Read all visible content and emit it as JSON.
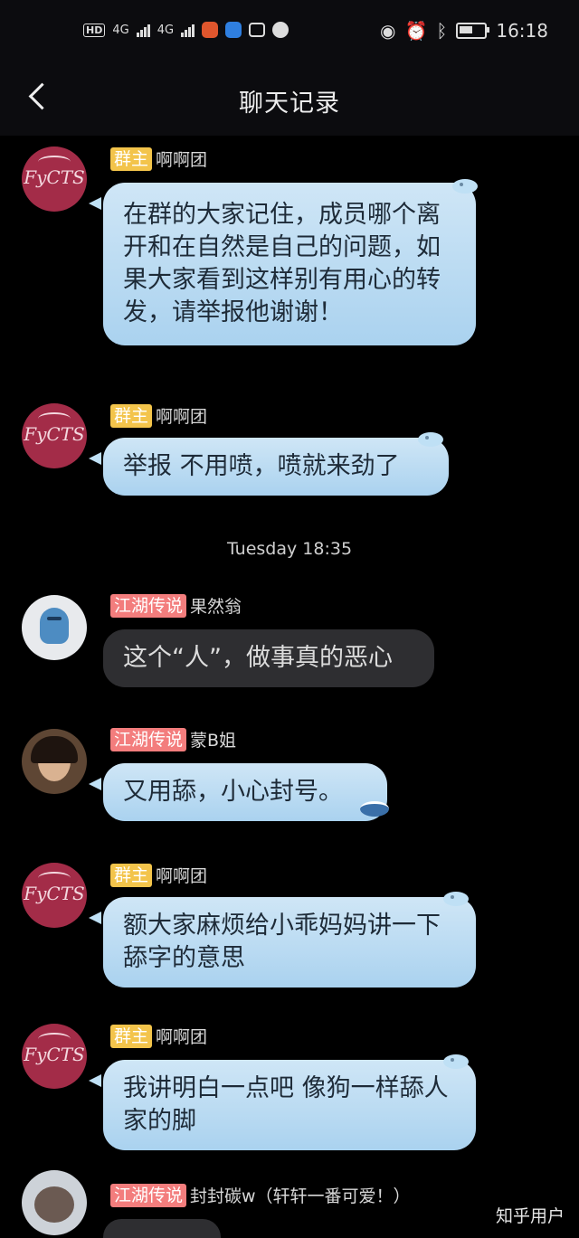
{
  "status_bar": {
    "hd_label": "HD",
    "signal1": "4G",
    "signal2": "4G",
    "time": "16:18",
    "icons": [
      "hd-icon",
      "signal-icon",
      "signal-icon",
      "app-icon",
      "shield-icon",
      "bilibili-icon",
      "wechat-icon",
      "eye-icon",
      "alarm-icon",
      "bluetooth-icon",
      "battery-icon"
    ]
  },
  "header": {
    "title": "聊天记录"
  },
  "messages": [
    {
      "badge": "群主",
      "sender": "啊啊团",
      "text": "在群的大家记住，成员哪个离开和在自然是自己的问题，如果大家看到这样别有用心的转发，请举报他谢谢！"
    },
    {
      "badge": "群主",
      "sender": "啊啊团",
      "text": "举报 不用喷，喷就来劲了"
    },
    {
      "timestamp": "Tuesday 18:35"
    },
    {
      "badge": "江湖传说",
      "sender": "果然翁",
      "text": "这个“人”，做事真的恶心"
    },
    {
      "badge": "江湖传说",
      "sender": "蒙B姐",
      "text": "又用舔，小心封号。"
    },
    {
      "badge": "群主",
      "sender": "啊啊团",
      "text": "额大家麻烦给小乖妈妈讲一下舔字的意思"
    },
    {
      "badge": "群主",
      "sender": "啊啊团",
      "text": "我讲明白一点吧 像狗一样舔人家的脚"
    },
    {
      "badge": "江湖传说",
      "sender": "封封碳w（轩轩一番可爱！）"
    }
  ],
  "watermark": "知乎用户",
  "colors": {
    "background": "#000000",
    "bubble_blue": "#b9dcf3",
    "bubble_gray": "#2e2e31",
    "badge_owner": "#f3c44b",
    "badge_legend": "#f37d7d",
    "avatar_red": "#a32c48"
  }
}
